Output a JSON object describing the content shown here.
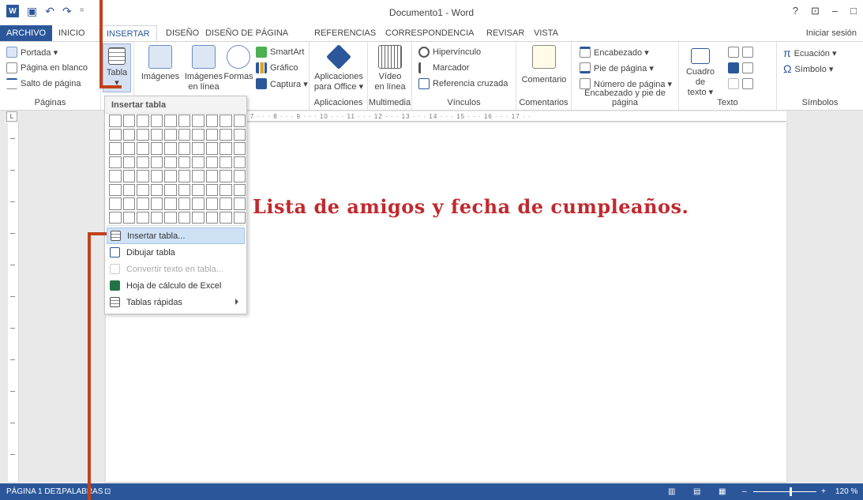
{
  "window": {
    "title": "Documento1 - Word",
    "help": "?",
    "minimize": "–",
    "restore": "□"
  },
  "tabs": [
    "ARCHIVO",
    "INICIO",
    "INSERTAR",
    "DISEÑO",
    "DISEÑO DE PÁGINA",
    "REFERENCIAS",
    "CORRESPONDENCIA",
    "REVISAR",
    "VISTA"
  ],
  "active_tab": "INSERTAR",
  "signin": "Iniciar sesión",
  "ribbon": {
    "paginas": {
      "label": "Páginas",
      "items": [
        "Portada ▾",
        "Página en blanco",
        "Salto de página"
      ]
    },
    "tabla": {
      "label": "Tabla",
      "arrow": "▾"
    },
    "ilustraciones": {
      "imagenes": "Imágenes",
      "imagenes_linea_1": "Imágenes",
      "imagenes_linea_2": "en línea",
      "formas": "Formas",
      "smartart": "SmartArt",
      "grafico": "Gráfico",
      "captura": "Captura ▾"
    },
    "aplicaciones": {
      "label": "Aplicaciones",
      "line1": "Aplicaciones",
      "line2": "para Office ▾"
    },
    "multimedia": {
      "label": "Multimedia",
      "line1": "Vídeo",
      "line2": "en línea"
    },
    "vinculos": {
      "label": "Vínculos",
      "items": [
        "Hipervínculo",
        "Marcador",
        "Referencia cruzada"
      ]
    },
    "comentarios": {
      "label": "Comentarios",
      "button": "Comentario"
    },
    "encabezado": {
      "label": "Encabezado y pie de página",
      "items": [
        "Encabezado ▾",
        "Pie de página ▾",
        "Número de página ▾"
      ]
    },
    "texto": {
      "label": "Texto",
      "line1": "Cuadro de",
      "line2": "texto ▾"
    },
    "simbolos": {
      "label": "Símbolos",
      "items": [
        "Ecuación ▾",
        "Símbolo ▾"
      ]
    }
  },
  "ruler_text": "· 1 · · · 2 · · · 3 · · · 4 · · · 5 · · · 6 · · · 7 · · · 8 · · · 9 · · · 10 · · · 11 · · · 12 · · · 13 · · · 14 · · · 15 · · · 16 · · · 17 · ·",
  "ruler_corner": "L",
  "document": {
    "heading": "Lista de amigos y fecha de cumpleaños."
  },
  "dropdown": {
    "header": "Insertar tabla",
    "items": [
      {
        "label": "Insertar tabla...",
        "state": "hover"
      },
      {
        "label": "Dibujar tabla",
        "state": "normal"
      },
      {
        "label": "Convertir texto en tabla...",
        "state": "disabled"
      },
      {
        "label": "Hoja de cálculo de Excel",
        "state": "normal"
      },
      {
        "label": "Tablas rápidas",
        "state": "normal"
      }
    ]
  },
  "status": {
    "page": "PÁGINA 1 DE 1",
    "words": "7 PALABRAS",
    "zoom": "120 %"
  },
  "colors": {
    "accent": "#2b579a",
    "heading": "#c0292e",
    "annotation": "#c0421c"
  }
}
